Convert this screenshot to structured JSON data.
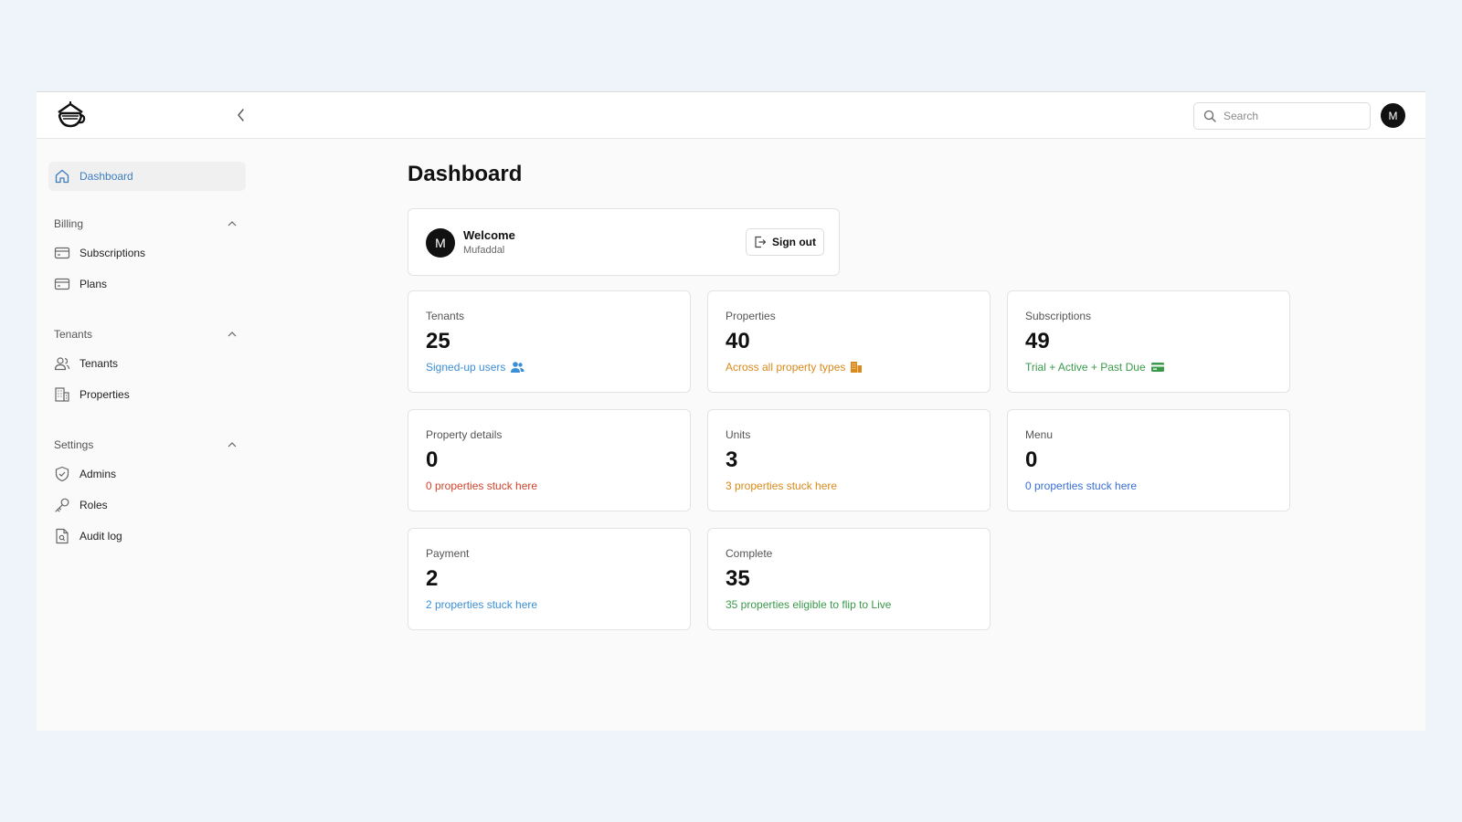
{
  "header": {
    "search_placeholder": "Search",
    "avatar_initial": "M"
  },
  "sidebar": {
    "active": {
      "label": "Dashboard",
      "icon": "home-icon"
    },
    "sections": [
      {
        "title": "Billing",
        "items": [
          {
            "label": "Subscriptions",
            "icon": "credit-card-icon"
          },
          {
            "label": "Plans",
            "icon": "credit-card-icon"
          }
        ]
      },
      {
        "title": "Tenants",
        "items": [
          {
            "label": "Tenants",
            "icon": "users-icon"
          },
          {
            "label": "Properties",
            "icon": "building-icon"
          }
        ]
      },
      {
        "title": "Settings",
        "items": [
          {
            "label": "Admins",
            "icon": "shield-check-icon"
          },
          {
            "label": "Roles",
            "icon": "key-icon"
          },
          {
            "label": "Audit log",
            "icon": "file-search-icon"
          }
        ]
      }
    ]
  },
  "main": {
    "title": "Dashboard",
    "welcome": {
      "avatar_initial": "M",
      "title": "Welcome",
      "name": "Mufaddal",
      "signout_label": "Sign out"
    },
    "stats": [
      {
        "label": "Tenants",
        "value": "25",
        "sub": "Signed-up users",
        "color": "#3b8fd6",
        "icon": "users-icon"
      },
      {
        "label": "Properties",
        "value": "40",
        "sub": "Across all property types",
        "color": "#d98a1a",
        "icon": "building-icon"
      },
      {
        "label": "Subscriptions",
        "value": "49",
        "sub": "Trial + Active + Past Due",
        "color": "#3a9a4a",
        "icon": "credit-card-icon"
      },
      {
        "label": "Property details",
        "value": "0",
        "sub": "0 properties stuck here",
        "color": "#d0452b",
        "icon": ""
      },
      {
        "label": "Units",
        "value": "3",
        "sub": "3 properties stuck here",
        "color": "#d98a1a",
        "icon": ""
      },
      {
        "label": "Menu",
        "value": "0",
        "sub": "0 properties stuck here",
        "color": "#3a6fd6",
        "icon": ""
      },
      {
        "label": "Payment",
        "value": "2",
        "sub": "2 properties stuck here",
        "color": "#3b8fd6",
        "icon": ""
      },
      {
        "label": "Complete",
        "value": "35",
        "sub": "35 properties eligible to flip to Live",
        "color": "#3a9a4a",
        "icon": ""
      }
    ]
  },
  "colors": {
    "accent_blue": "#3b7dbf",
    "background": "#eff3fa"
  }
}
